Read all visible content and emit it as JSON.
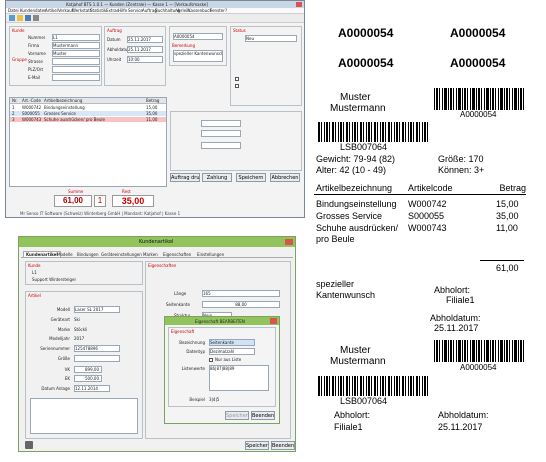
{
  "app": {
    "title": "Katjahof BTS 1.0.1 — Kunden (Zentrale) — Kasse 1 — [Verkaufsmaske]",
    "menu": [
      "Datei",
      "Kundendaten",
      "Artikel",
      "Verkauf",
      "Werkstatt",
      "Statistik",
      "Extras",
      "Hilfe",
      "Service",
      "Auftrag",
      "Buchhaltung",
      "Verleih",
      "Kassenbuch",
      "Fenster",
      "?"
    ],
    "kunde_section": "Kunde",
    "kunde_fields": [
      "Nummer",
      "Titel",
      "Firma",
      "Vorname",
      "Name",
      "Strasse",
      "PLZ/Ort",
      "Telefon",
      "E-Mail"
    ],
    "kunde_values": [
      "L1",
      "",
      "Mustermann",
      "Muster",
      "",
      "",
      "",
      "",
      ""
    ],
    "gruppe_label": "Gruppe",
    "rabatt_label": "Rabatt",
    "auftrag_section": "Auftrag",
    "auftrag_number": "A0000054",
    "auftrag_fields": [
      "Datum",
      "Abholdatum",
      "Uhrzeit"
    ],
    "auftrag_values": [
      "25.11.2017",
      "25.11.2017",
      "10:00"
    ],
    "status_section": "Status",
    "status_value": "Neu",
    "bemerkung_label": "Bemerkung",
    "bemerkung_value": "spezieller Kantenwunsch",
    "table_headers": [
      "Nr.",
      "Art.-Code",
      "Artikelbezeichnung",
      "Menge",
      "Preis",
      "Betrag"
    ],
    "table_rows": [
      {
        "nr": "1",
        "code": "W000742",
        "name": "Bindungseinstellung",
        "menge": "1",
        "preis": "15,00",
        "betrag": "15,00"
      },
      {
        "nr": "2",
        "code": "S000055",
        "name": "Grosses Service",
        "menge": "1",
        "preis": "35,00",
        "betrag": "35,00"
      },
      {
        "nr": "3",
        "code": "W000743",
        "name": "Schuhe ausdrücken/ pro Beule",
        "menge": "1",
        "preis": "11,00",
        "betrag": "11,00"
      }
    ],
    "summe_label": "Summe",
    "summe_value": "61,00",
    "anzahl_value": "1",
    "rest_label": "Rest",
    "rest_value": "35,00",
    "buttons": [
      "Auftrag drucken",
      "Zahlung",
      "Speichern",
      "Abbrechen"
    ],
    "statusbar": "Mr Senso IT Software (Schweiz) Winterberg GmbH  |  Mandant: Katjahof  |  Kasse 1"
  },
  "dialog": {
    "title": "Kundenartikel",
    "tabs": [
      "Kundenartikel",
      "Modelle",
      "Bindungen",
      "Geräteeinstellungen",
      "Marken",
      "Eigenschaften",
      "Einstellungen"
    ],
    "kunde_label": "Kunde",
    "kunde_nr": "L1",
    "kunde_name": "Support Wintersteiger",
    "artikel_label": "Artikel",
    "eigenschaften_label": "Eigenschaften",
    "fields": [
      "Modell",
      "Geräteart",
      "Marke",
      "Modelljahr",
      "Seriennummer",
      "Größe",
      "VK",
      "EK",
      "Datum Anlage"
    ],
    "values": [
      "Laser SL 2017",
      "Ski",
      "Stöckli",
      "2017",
      "125478896",
      "",
      "899,00",
      "500,00",
      "12.11.2014"
    ],
    "right_fields": [
      "Länge",
      "Seitenkante",
      "Struktur"
    ],
    "right_values": [
      "165",
      "88,00",
      "Nein"
    ],
    "buttons": [
      "Speichern",
      "Beenden"
    ]
  },
  "subdialog": {
    "title": "Eigenschaft BEARBEITEN",
    "section": "Eigenschaft",
    "fields": [
      "Bezeichnung",
      "Datentyp",
      "Listenwerte",
      "Beispiel"
    ],
    "bezeichnung_value": "Seitenkante",
    "datentyp_value": "Dezimalzahl",
    "checkbox_label": "Nur aus Liste",
    "listenwerte_value": "86|87|88|89",
    "beispiel_value": "3|4|5",
    "buttons": [
      "Speichern",
      "Beenden"
    ]
  },
  "receipt": {
    "auftrag_nr": "A0000054",
    "kunde_name": [
      "Muster",
      "Mustermann"
    ],
    "lsb": "LSB007064",
    "gewicht": "Gewicht: 79-94 (82)",
    "alter": "Alter: 42 (10 - 49)",
    "groesse": "Größe: 170",
    "koennen": "Können: 3+",
    "col_headers": [
      "Artikelbezeichnung",
      "Artikelcode",
      "Betrag"
    ],
    "items": [
      {
        "name": "Bindungseinstellung",
        "code": "W000742",
        "betrag": "15,00"
      },
      {
        "name": "Grosses Service",
        "code": "S000055",
        "betrag": "35,00"
      },
      {
        "name": "Schuhe ausdrücken/ pro Beule",
        "code": "W000743",
        "betrag": "11,00"
      }
    ],
    "total": "61,00",
    "bemerkung": "spezieller Kantenwunsch",
    "abholort_label": "Abholort:",
    "abholort_value": "Filiale1",
    "abholdatum_label": "Abholdatum:",
    "abholdatum_value": "25.11.2017"
  }
}
